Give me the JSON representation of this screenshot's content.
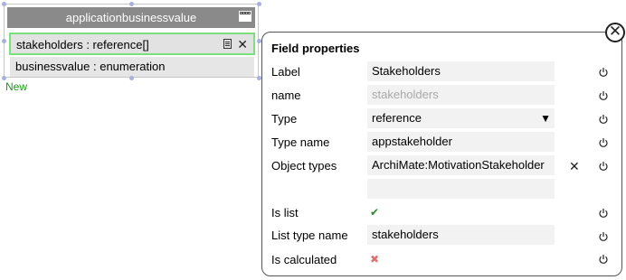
{
  "entity": {
    "title": "applicationbusinessvalue",
    "fields": [
      {
        "label": "stakeholders : reference[]"
      },
      {
        "label": "businessvalue : enumeration"
      }
    ],
    "new_label": "New"
  },
  "panel": {
    "title": "Field properties",
    "close_glyph": "✕",
    "rows": [
      {
        "label": "Label",
        "value": "Stakeholders"
      },
      {
        "label": "name",
        "value": "stakeholders"
      },
      {
        "label": "Type",
        "value": "reference",
        "caret": "▼"
      },
      {
        "label": "Type name",
        "value": "appstakeholder"
      },
      {
        "label": "Object types",
        "value": "ArchiMate:MotivationStakeholder",
        "extra_value": "",
        "remove_glyph": "✕"
      },
      {
        "label": "Is list",
        "value": "✔"
      },
      {
        "label": "List type name",
        "value": "stakeholders"
      },
      {
        "label": "Is calculated",
        "value": "✖"
      }
    ]
  },
  "icons": {
    "row_doc": "document-icon",
    "row_remove": "close-icon",
    "power": "power-icon",
    "window": "window-icon",
    "panel_close": "close-circle-icon"
  },
  "colors": {
    "header_bg": "#8a8a8a",
    "selection_border": "#7be07b",
    "new_link": "#1a9a1a",
    "check": "#2a8a2a",
    "cross": "#e07070"
  }
}
